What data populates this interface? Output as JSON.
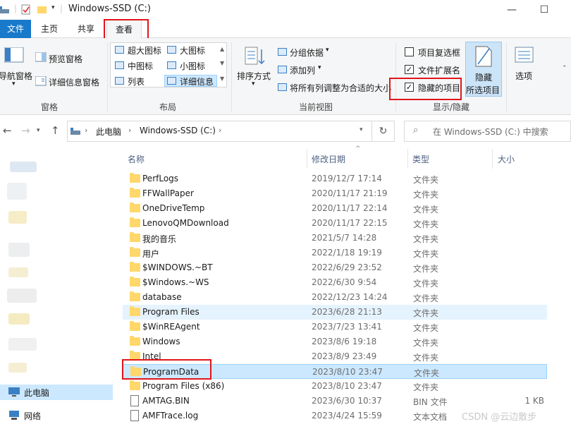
{
  "window": {
    "title": "Windows-SSD (C:)",
    "minimize": "—",
    "maximize": "☐"
  },
  "ribbon_tabs": [
    {
      "label": "文件"
    },
    {
      "label": "主页"
    },
    {
      "label": "共享"
    },
    {
      "label": "查看"
    }
  ],
  "panes": {
    "nav_pane": "导航窗格",
    "preview_pane": "预览窗格",
    "details_pane": "详细信息窗格",
    "group": "窗格"
  },
  "layout": {
    "extra_large": "超大图标",
    "large": "大图标",
    "medium": "中图标",
    "small": "小图标",
    "list": "列表",
    "details": "详细信息",
    "group": "布局"
  },
  "current_view": {
    "sort_by": "排序方式",
    "group_by": "分组依据",
    "add_columns": "添加列",
    "size_all_columns": "将所有列调整为合适的大小",
    "group": "当前视图"
  },
  "show_hide": {
    "item_checkboxes": "项目复选框",
    "item_checkboxes_checked": false,
    "file_extensions": "文件扩展名",
    "file_extensions_checked": true,
    "hidden_items": "隐藏的项目",
    "hidden_items_checked": true,
    "hide_selected_1": "隐藏",
    "hide_selected_2": "所选项目",
    "options": "选项",
    "group": "显示/隐藏"
  },
  "address": {
    "part1": "此电脑",
    "part2": "Windows-SSD (C:)",
    "search_placeholder": "在 Windows-SSD (C:) 中搜索"
  },
  "nav_pane_items": {
    "this_pc": "此电脑",
    "network": "网络"
  },
  "columns": {
    "name": "名称",
    "date": "修改日期",
    "type": "类型",
    "size": "大小"
  },
  "files": [
    {
      "name": "PerfLogs",
      "date": "2019/12/7 17:14",
      "type": "文件夹",
      "size": "",
      "kind": "folder"
    },
    {
      "name": "FFWallPaper",
      "date": "2020/11/17 21:19",
      "type": "文件夹",
      "size": "",
      "kind": "folder"
    },
    {
      "name": "OneDriveTemp",
      "date": "2020/11/17 22:14",
      "type": "文件夹",
      "size": "",
      "kind": "folder"
    },
    {
      "name": "LenovoQMDownload",
      "date": "2020/11/17 22:15",
      "type": "文件夹",
      "size": "",
      "kind": "folder"
    },
    {
      "name": "我的音乐",
      "date": "2021/5/7 14:28",
      "type": "文件夹",
      "size": "",
      "kind": "folder"
    },
    {
      "name": "用户",
      "date": "2022/1/18 19:19",
      "type": "文件夹",
      "size": "",
      "kind": "folder"
    },
    {
      "name": "$WINDOWS.~BT",
      "date": "2022/6/29 23:52",
      "type": "文件夹",
      "size": "",
      "kind": "folder"
    },
    {
      "name": "$Windows.~WS",
      "date": "2022/6/30 9:54",
      "type": "文件夹",
      "size": "",
      "kind": "folder"
    },
    {
      "name": "database",
      "date": "2022/12/23 14:24",
      "type": "文件夹",
      "size": "",
      "kind": "folder"
    },
    {
      "name": "Program Files",
      "date": "2023/6/28 21:13",
      "type": "文件夹",
      "size": "",
      "kind": "folder"
    },
    {
      "name": "$WinREAgent",
      "date": "2023/7/23 13:41",
      "type": "文件夹",
      "size": "",
      "kind": "folder"
    },
    {
      "name": "Windows",
      "date": "2023/8/6 19:18",
      "type": "文件夹",
      "size": "",
      "kind": "folder"
    },
    {
      "name": "Intel",
      "date": "2023/8/9 23:49",
      "type": "文件夹",
      "size": "",
      "kind": "folder"
    },
    {
      "name": "ProgramData",
      "date": "2023/8/10 23:47",
      "type": "文件夹",
      "size": "",
      "kind": "folder"
    },
    {
      "name": "Program Files (x86)",
      "date": "2023/8/10 23:47",
      "type": "文件夹",
      "size": "",
      "kind": "folder"
    },
    {
      "name": "AMTAG.BIN",
      "date": "2023/6/30 10:37",
      "type": "BIN 文件",
      "size": "1 KB",
      "kind": "file"
    },
    {
      "name": "AMFTrace.log",
      "date": "2023/4/24 15:59",
      "type": "文本文档",
      "size": "",
      "kind": "file"
    }
  ],
  "watermark": "CSDN @云边散步",
  "colors": {
    "accent": "#1979ca",
    "selection": "#cce8ff",
    "annotation": "#e0161c",
    "folder": "#ffd76a"
  }
}
